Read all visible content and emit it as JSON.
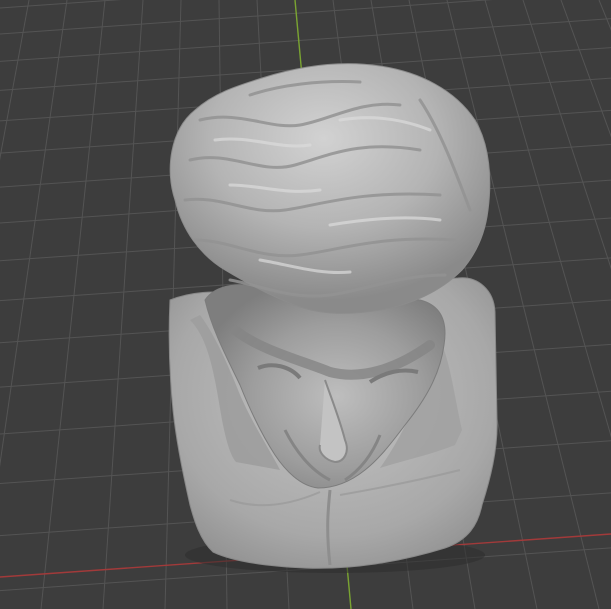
{
  "viewport": {
    "background_color": "#3d3d3d",
    "grid_line_color": "#545454",
    "x_axis_color": "#a23a3a",
    "y_axis_color": "#7aa431"
  },
  "model": {
    "subject": "sculpted-male-bust",
    "material_color": "#b4b4b4"
  }
}
